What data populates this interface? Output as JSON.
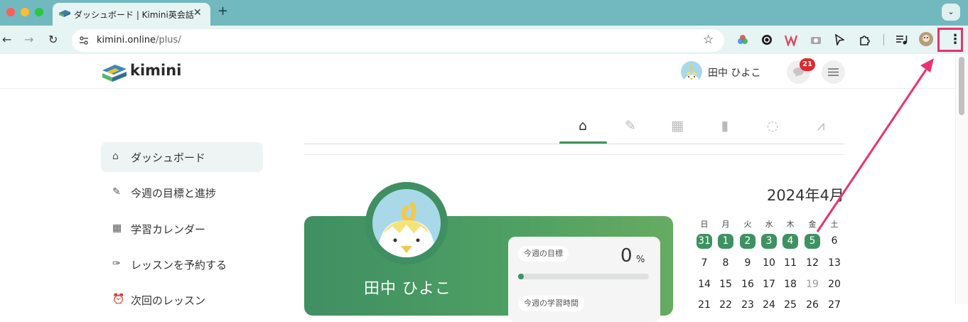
{
  "browser": {
    "tab_title": "ダッシュボード | Kimini英会話",
    "tab_close": "✕",
    "new_tab": "+",
    "tab_menu": "⌄",
    "url_host": "kimini.online",
    "url_path": "/plus/",
    "back": "←",
    "forward": "→",
    "reload": "↻",
    "star": "☆",
    "menu": "⋮"
  },
  "header": {
    "logo": "kimini",
    "user_name": "田中 ひよこ",
    "notification_count": "21"
  },
  "sidebar": {
    "items": [
      {
        "label": "ダッシュボード",
        "icon": "home-icon",
        "glyph": "⌂"
      },
      {
        "label": "今週の目標と進捗",
        "icon": "pencil-icon",
        "glyph": "✎"
      },
      {
        "label": "学習カレンダー",
        "icon": "calendar-icon",
        "glyph": "▦"
      },
      {
        "label": "レッスンを予約する",
        "icon": "feather-icon",
        "glyph": "✑"
      },
      {
        "label": "次回のレッスン",
        "icon": "alarm-clock-icon",
        "glyph": "⏰"
      }
    ]
  },
  "tabs": [
    {
      "icon": "home-icon",
      "glyph": "⌂"
    },
    {
      "icon": "pencil-icon",
      "glyph": "✎"
    },
    {
      "icon": "calendar-icon",
      "glyph": "▦"
    },
    {
      "icon": "book-icon",
      "glyph": "▮"
    },
    {
      "icon": "chat-icon",
      "glyph": "◌"
    },
    {
      "icon": "chart-icon",
      "glyph": "⩘"
    }
  ],
  "profile": {
    "name": "田中 ひよこ",
    "weekly_goal_label": "今週の目標",
    "weekly_goal_value": "0",
    "weekly_goal_unit": "%",
    "weekly_goal_progress": 0.03,
    "study_time_label": "今週の学習時間"
  },
  "calendar": {
    "month": "2024年4月",
    "weekdays": [
      "日",
      "月",
      "火",
      "水",
      "木",
      "金",
      "土"
    ],
    "rows": [
      [
        "31",
        "1",
        "2",
        "3",
        "4",
        "5",
        "6"
      ],
      [
        "7",
        "8",
        "9",
        "10",
        "11",
        "12",
        "13"
      ],
      [
        "14",
        "15",
        "16",
        "17",
        "18",
        "19",
        "20"
      ],
      [
        "21",
        "22",
        "23",
        "24",
        "25",
        "26",
        "27"
      ]
    ],
    "highlighted": [
      "31",
      "1",
      "2",
      "3",
      "4",
      "5"
    ],
    "muted": [
      "19"
    ]
  },
  "colors": {
    "accent": "#3f9161",
    "annotation": "#e8336e",
    "badge": "#e0282d"
  }
}
